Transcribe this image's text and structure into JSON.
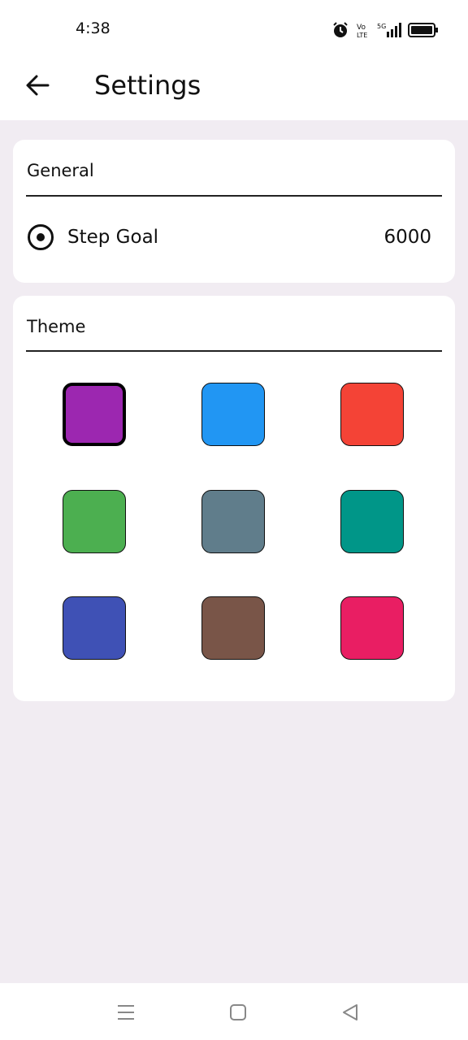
{
  "status_bar": {
    "time": "4:38",
    "icons": [
      "alarm-icon",
      "volte-icon",
      "5g-signal-icon",
      "battery-icon"
    ]
  },
  "app_bar": {
    "title": "Settings",
    "back_icon": "arrow-left-icon"
  },
  "general": {
    "header": "General",
    "step_goal": {
      "label": "Step Goal",
      "value": "6000",
      "icon": "radio-target-icon"
    }
  },
  "theme": {
    "header": "Theme",
    "selected_index": 0,
    "swatches": [
      {
        "name": "purple",
        "color": "#9c27b0"
      },
      {
        "name": "blue",
        "color": "#2196f3"
      },
      {
        "name": "red",
        "color": "#f44336"
      },
      {
        "name": "green",
        "color": "#4caf50"
      },
      {
        "name": "blue-grey",
        "color": "#607d8b"
      },
      {
        "name": "teal",
        "color": "#009688"
      },
      {
        "name": "indigo",
        "color": "#3f51b5"
      },
      {
        "name": "brown",
        "color": "#795548"
      },
      {
        "name": "pink",
        "color": "#e91e63"
      }
    ]
  },
  "nav_bar": {
    "icons": [
      "menu-icon",
      "home-square-icon",
      "back-triangle-icon"
    ]
  }
}
